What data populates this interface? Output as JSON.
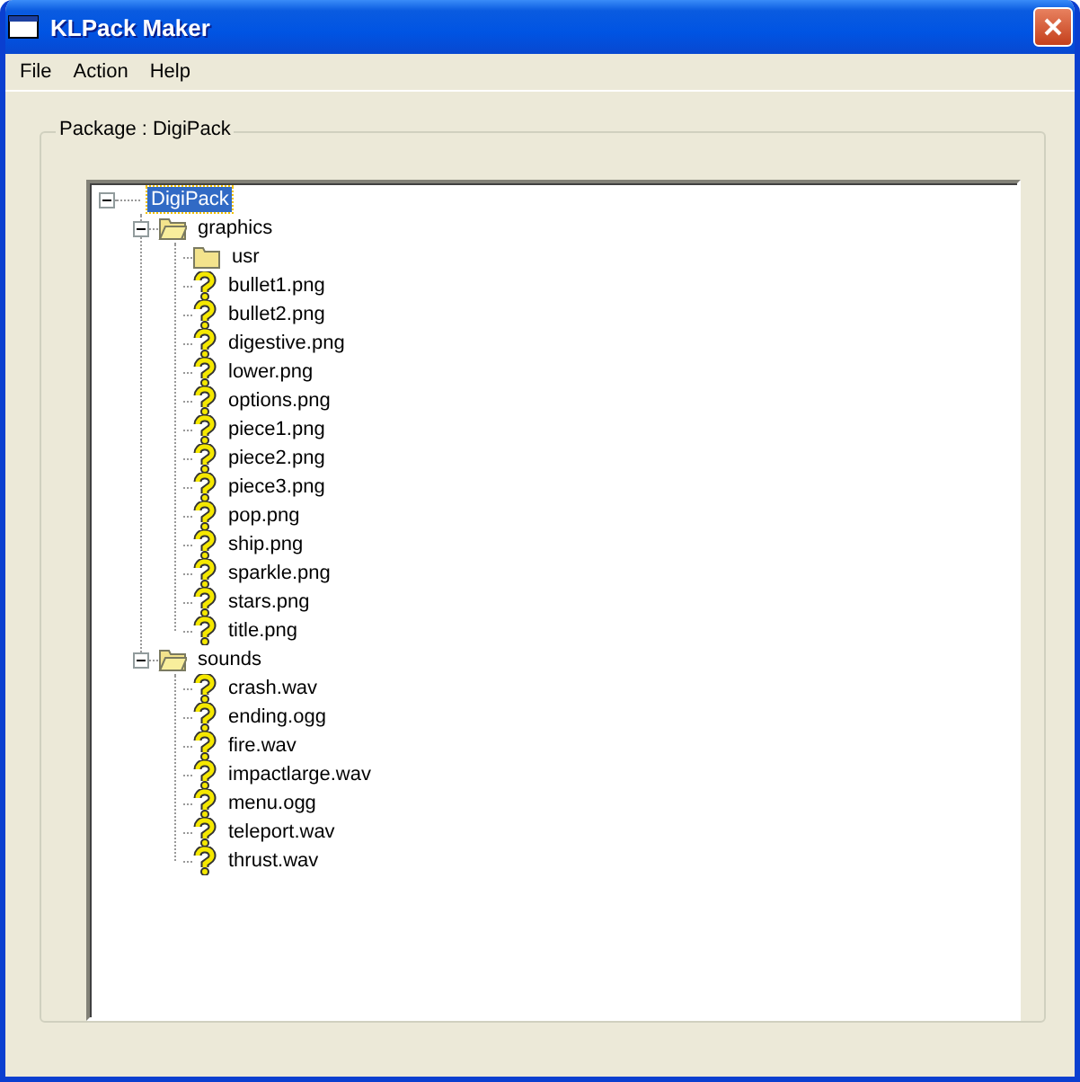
{
  "window": {
    "title": "KLPack Maker"
  },
  "menu": [
    "File",
    "Action",
    "Help"
  ],
  "group": {
    "label": "Package : DigiPack"
  },
  "tree": [
    {
      "kind": "root",
      "label": "DigiPack",
      "selected": true,
      "expanded": true,
      "children": [
        {
          "kind": "folder",
          "label": "graphics",
          "selected": false,
          "expanded": true,
          "children": [
            {
              "kind": "folder",
              "label": "usr",
              "selected": false
            },
            {
              "kind": "file",
              "label": "bullet1.png",
              "selected": false
            },
            {
              "kind": "file",
              "label": "bullet2.png",
              "selected": false
            },
            {
              "kind": "file",
              "label": "digestive.png",
              "selected": false
            },
            {
              "kind": "file",
              "label": "lower.png",
              "selected": false
            },
            {
              "kind": "file",
              "label": "options.png",
              "selected": false
            },
            {
              "kind": "file",
              "label": "piece1.png",
              "selected": false
            },
            {
              "kind": "file",
              "label": "piece2.png",
              "selected": false
            },
            {
              "kind": "file",
              "label": "piece3.png",
              "selected": false
            },
            {
              "kind": "file",
              "label": "pop.png",
              "selected": false
            },
            {
              "kind": "file",
              "label": "ship.png",
              "selected": false
            },
            {
              "kind": "file",
              "label": "sparkle.png",
              "selected": false
            },
            {
              "kind": "file",
              "label": "stars.png",
              "selected": false
            },
            {
              "kind": "file",
              "label": "title.png",
              "selected": false
            }
          ]
        },
        {
          "kind": "folder",
          "label": "sounds",
          "selected": false,
          "expanded": true,
          "children": [
            {
              "kind": "file",
              "label": "crash.wav",
              "selected": false
            },
            {
              "kind": "file",
              "label": "ending.ogg",
              "selected": false
            },
            {
              "kind": "file",
              "label": "fire.wav",
              "selected": false
            },
            {
              "kind": "file",
              "label": "impactlarge.wav",
              "selected": false
            },
            {
              "kind": "file",
              "label": "menu.ogg",
              "selected": false
            },
            {
              "kind": "file",
              "label": "teleport.wav",
              "selected": false
            },
            {
              "kind": "file",
              "label": "thrust.wav",
              "selected": false
            }
          ]
        }
      ]
    }
  ]
}
